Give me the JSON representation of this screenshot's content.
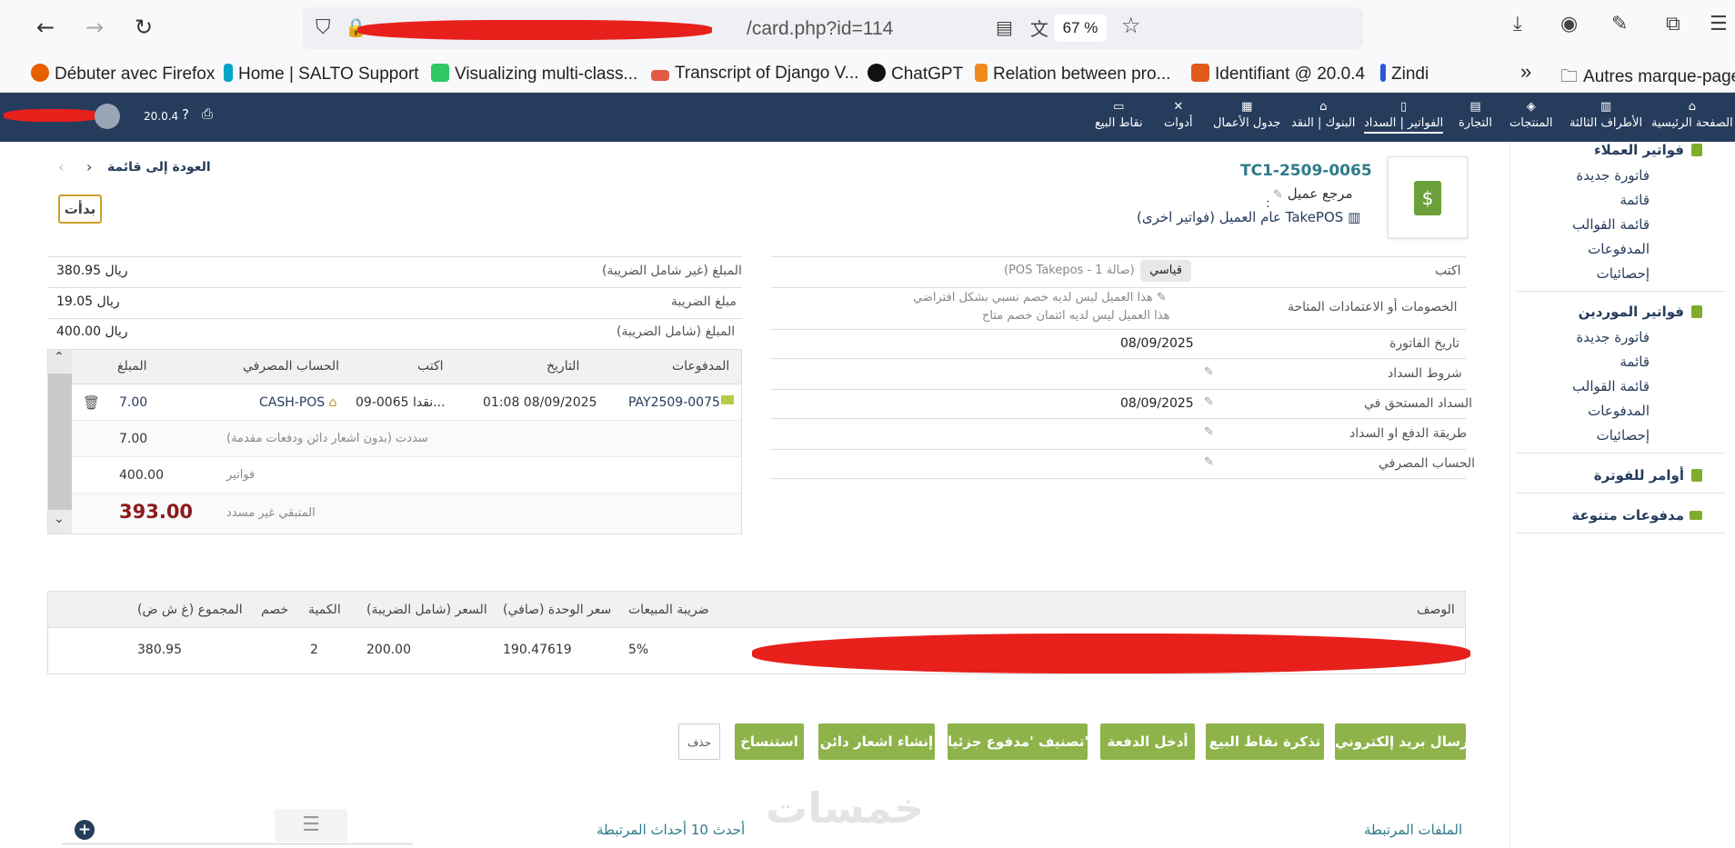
{
  "browser": {
    "url_tail": "/card.php?id=114",
    "zoom": "67 %",
    "bookmarks": [
      {
        "label": "Débuter avec Firefox",
        "color": "#e66000"
      },
      {
        "label": "Home | SALTO Support",
        "color": "#00a5c8"
      },
      {
        "label": "Visualizing multi-class...",
        "color": "#2ec866"
      },
      {
        "label": "Transcript of Django V...",
        "color": "#e05a47"
      },
      {
        "label": "ChatGPT",
        "color": "#111111"
      },
      {
        "label": "Relation between pro...",
        "color": "#f08a1c"
      },
      {
        "label": "Identifiant @ 20.0.4",
        "color": "#e05a1c"
      },
      {
        "label": "Zindi",
        "color": "#2a5ad8"
      }
    ],
    "more_bookmarks": "Autres marque-page"
  },
  "appbar": {
    "version": "20.0.4",
    "menus": [
      {
        "label": "الصفحة الرئيسية",
        "icon": "home-icon",
        "glyph": "⌂"
      },
      {
        "label": "الأطراف الثالثة",
        "icon": "building-icon",
        "glyph": "▥"
      },
      {
        "label": "المنتجات",
        "icon": "cube-icon",
        "glyph": "◈"
      },
      {
        "label": "التجارة",
        "icon": "briefcase-icon",
        "glyph": "▤"
      },
      {
        "label": "الفواتير | السداد",
        "icon": "invoice-icon",
        "glyph": "▯"
      },
      {
        "label": "البنوك | النقد",
        "icon": "bank-icon",
        "glyph": "⌂"
      },
      {
        "label": "جدول الأعمال",
        "icon": "calendar-icon",
        "glyph": "▦"
      },
      {
        "label": "أدوات",
        "icon": "tools-icon",
        "glyph": "✕"
      },
      {
        "label": "نقاط البيع",
        "icon": "pos-icon",
        "glyph": "▭"
      }
    ]
  },
  "sidebar": {
    "customer_invoices": {
      "title": "فواتير العملاء",
      "items": [
        "فاتورة جديدة",
        "قائمة",
        "قائمة القوالب",
        "المدفوعات",
        "إحصائيات"
      ]
    },
    "supplier_invoices": {
      "title": "فواتير الموردين",
      "items": [
        "فاتورة جديدة",
        "قائمة",
        "قائمة القوالب",
        "المدفوعات",
        "إحصائيات"
      ]
    },
    "billing_orders": "أوامر للفوترة",
    "various_payments": "مدفوعات متنوعة"
  },
  "invoice": {
    "ref": "TC1-2509-0065",
    "customer_ref_label": "مرجع عميل",
    "customer_ref_value": ":",
    "customer": "TakePOS عام العميل",
    "other_invoices": "(فواتير اخرى)",
    "back_to_list": "العودة إلى قائمة",
    "status": "بدأت",
    "fields": {
      "type_label": "اكتب",
      "type_badge": "قياسي",
      "type_note": "(POS Takepos - صالة 1)",
      "discounts_label": "الخصومات أو الاعتمادات المتاحة",
      "discount_line1": "هذا العميل ليس لديه خصم نسبي بشكل افتراضي",
      "discount_line2": "هذا العميل ليس لديه ائتمان خصم متاح",
      "invoice_date_label": "تاريخ الفاتورة",
      "invoice_date": "08/09/2025",
      "payment_terms_label": "شروط السداد",
      "due_date_label": "السداد المستحق في",
      "due_date": "08/09/2025",
      "payment_method_label": "طريقة الدفع او السداد",
      "bank_account_label": "الحساب المصرفي"
    },
    "amounts": {
      "ht_label": "المبلغ (غير شامل الضريبة)",
      "ht": "380.95 ريال",
      "tax_label": "مبلغ الضريبة",
      "tax": "19.05 ريال",
      "ttc_label": "المبلغ (شامل الضريبة)",
      "ttc": "400.00 ريال"
    },
    "payments": {
      "headers": {
        "payment": "المدفوعات",
        "date": "التاريخ",
        "type": "اكتب",
        "account": "الحساب المصرفي",
        "amount": "المبلغ"
      },
      "row": {
        "ref": "PAY2509-0075",
        "date": "01:08 08/09/2025",
        "type": "نقدا 0065-09...",
        "account": "CASH-POS",
        "amount": "7.00"
      },
      "paid_label": "سددت (بدون اشعار دائن ودفعات مقدمة)",
      "paid": "7.00",
      "invoices_label": "فواتير",
      "invoices": "400.00",
      "remaining_label": "المتبقي غير مسدد",
      "remaining": "393.00"
    },
    "lines": {
      "headers": {
        "desc": "الوصف",
        "vat": "ضريبة المبيعات",
        "pu_ht": "سعر الوحدة (صافي)",
        "pu_ttc": "السعر (شامل الضريبة)",
        "qty": "الكمية",
        "discount": "خصم",
        "total_ht": "المجموع (غ ش ض)"
      },
      "row": {
        "vat": "5%",
        "pu_ht": "190.47619",
        "pu_ttc": "200.00",
        "qty": "2",
        "total_ht": "380.95"
      }
    },
    "actions": {
      "send_email": "إرسال بريد إلكتروني",
      "pos_ticket": "تذكرة نقاط البيع",
      "enter_payment": "أدخل الدفعة",
      "classify_partial": "تصنيف 'مدفوع جزئيا'",
      "credit_note": "إنشاء اشعار دائن",
      "clone": "استنساخ",
      "delete": "حذف"
    },
    "linked_files": "الملفات المرتبطة",
    "latest_events": "أحدث 10 أحداث المرتبطة",
    "watermark": "خمسات"
  },
  "colors": {
    "appbar": "#263c5c",
    "accent_green": "#8db34a",
    "remaining": "#8b1a1a",
    "link": "#263c5c"
  }
}
